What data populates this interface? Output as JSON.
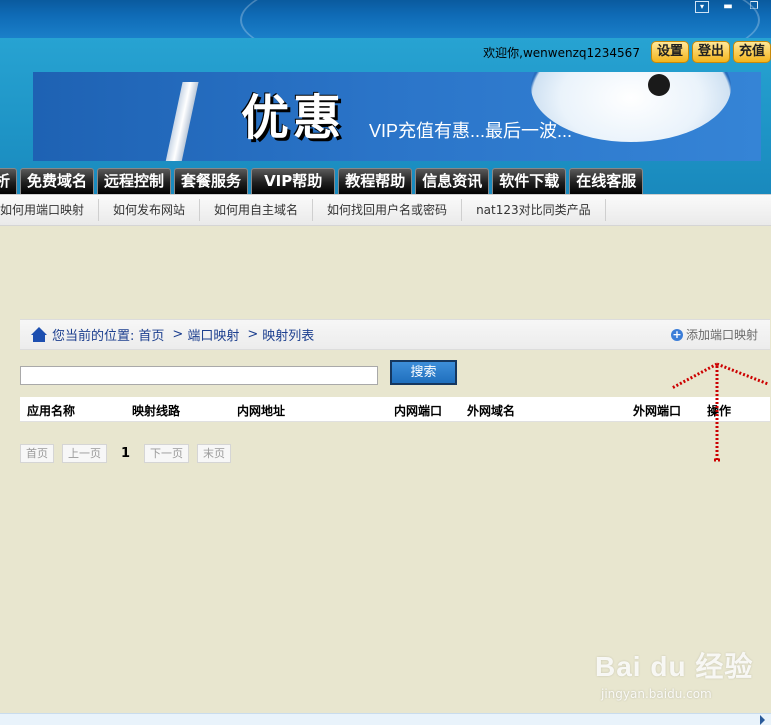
{
  "window": {
    "menu_icon": "menu-icon",
    "minimize_icon": "minimize-icon",
    "restore_icon": "restore-icon"
  },
  "user": {
    "welcome": "欢迎你,wenwenzq1234567",
    "settings_label": "设置",
    "logout_label": "登出",
    "recharge_label": "充值"
  },
  "banner": {
    "big_text": "优惠",
    "sub_text": "VIP充值有惠...最后一波..."
  },
  "nav": {
    "items": [
      "析",
      "免费域名",
      "远程控制",
      "套餐服务",
      "VIP帮助",
      "教程帮助",
      "信息资讯",
      "软件下载",
      "在线客服"
    ]
  },
  "subnav": {
    "items": [
      "如何用端口映射",
      "如何发布网站",
      "如何用自主域名",
      "如何找回用户名或密码",
      "nat123对比同类产品"
    ]
  },
  "breadcrumb": {
    "label": "您当前的位置:",
    "items": [
      "首页",
      "端口映射",
      "映射列表"
    ],
    "separator": ">",
    "add_label": "添加端口映射"
  },
  "search": {
    "value": "",
    "button_label": "搜索"
  },
  "table": {
    "columns": [
      "应用名称",
      "映射线路",
      "内网地址",
      "内网端口",
      "外网域名",
      "外网端口",
      "操作"
    ]
  },
  "pagination": {
    "first": "首页",
    "prev": "上一页",
    "current": "1",
    "next": "下一页",
    "last": "末页"
  },
  "watermark": {
    "top": "Bai du 经验",
    "bottom": "jingyan.baidu.com"
  },
  "colors": {
    "accent": "#1d4fb0",
    "background": "#e8e6cf",
    "button_gold": "#f4b41b",
    "annotation_red": "#cc0000"
  }
}
